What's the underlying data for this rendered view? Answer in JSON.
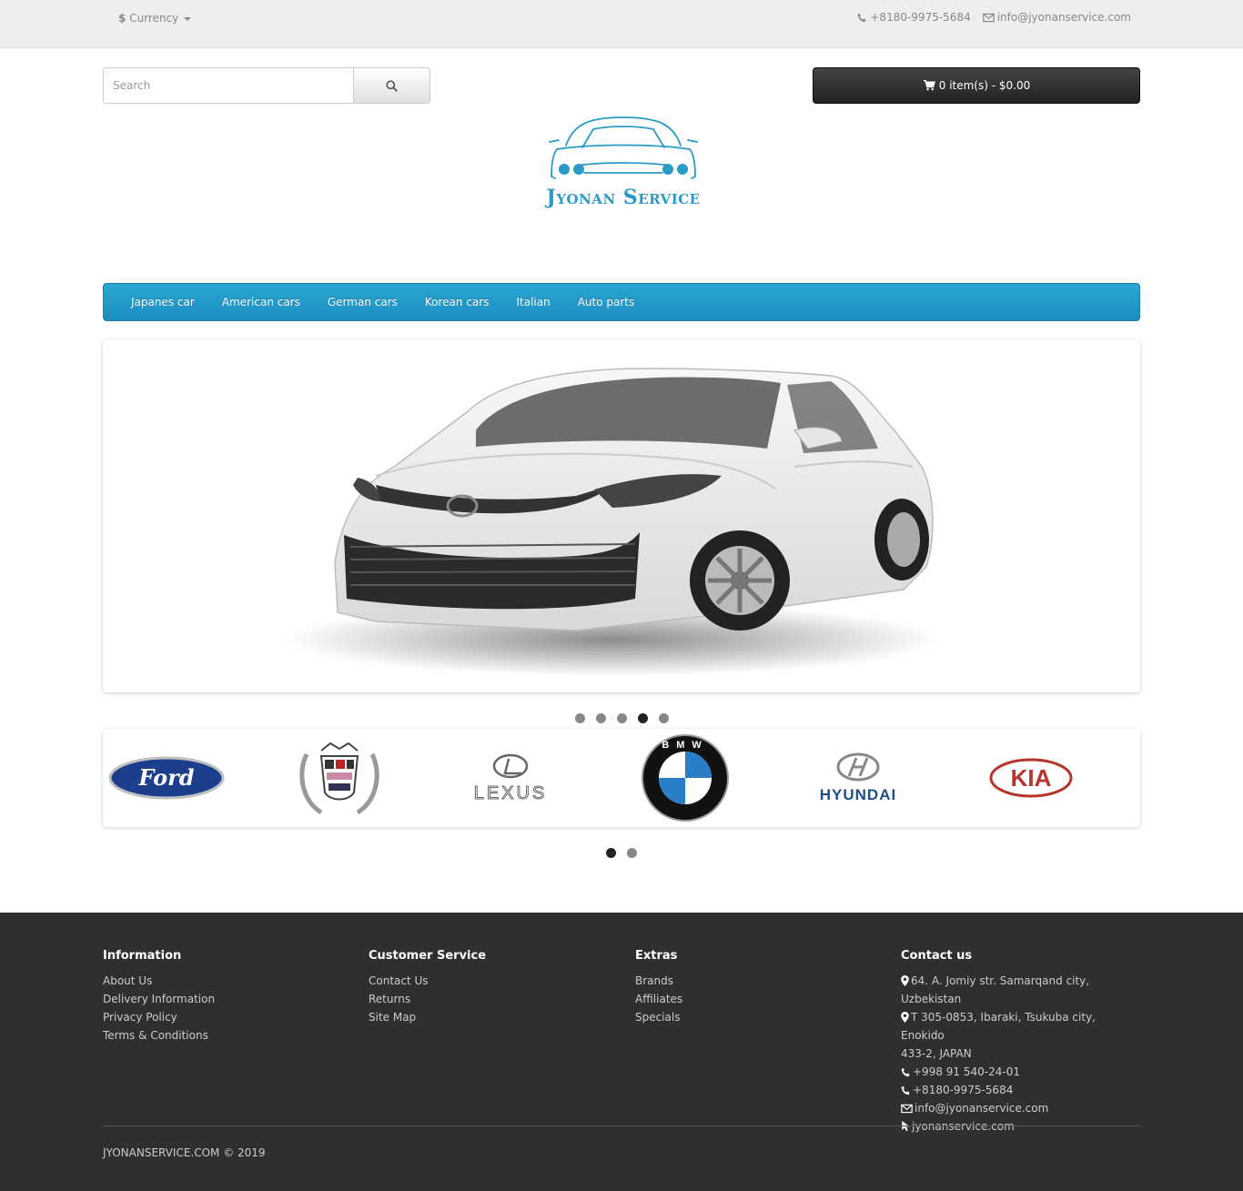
{
  "topbar": {
    "currency_symbol": "$",
    "currency_label": "Currency",
    "phone": "+8180-9975-5684",
    "email": "info@jyonanservice.com"
  },
  "search": {
    "placeholder": "Search"
  },
  "cart": {
    "label": "0 item(s) - $0.00"
  },
  "logo": {
    "text": "Jyonan Service",
    "color": "#2a9bc9"
  },
  "nav": {
    "items": [
      {
        "label": "Japanes car"
      },
      {
        "label": "American cars"
      },
      {
        "label": "German cars"
      },
      {
        "label": "Korean cars"
      },
      {
        "label": "Italian"
      },
      {
        "label": "Auto parts"
      }
    ]
  },
  "slideshow": {
    "slide_count": 5,
    "active_index": 3,
    "image": "white-toyota-camry"
  },
  "brands": {
    "items": [
      {
        "name": "Ford",
        "label": "Ford"
      },
      {
        "name": "Cadillac",
        "label": ""
      },
      {
        "name": "Lexus",
        "label": "LEXUS"
      },
      {
        "name": "BMW",
        "label": "BMW"
      },
      {
        "name": "Hyundai",
        "label": "HYUNDAI"
      },
      {
        "name": "KIA",
        "label": "KIA"
      }
    ],
    "page_count": 2,
    "active_page": 0
  },
  "footer": {
    "information": {
      "title": "Information",
      "links": [
        "About Us",
        "Delivery Information",
        "Privacy Policy",
        "Terms & Conditions"
      ]
    },
    "customer_service": {
      "title": "Customer Service",
      "links": [
        "Contact Us",
        "Returns",
        "Site Map"
      ]
    },
    "extras": {
      "title": "Extras",
      "links": [
        "Brands",
        "Affiliates",
        "Specials"
      ]
    },
    "contact": {
      "title": "Contact us",
      "address1": "64. A. Jomiy str. Samarqand city, Uzbekistan",
      "address2_line1": "T 305-0853, Ibaraki, Tsukuba city, Enokido",
      "address2_line2": "433-2, JAPAN",
      "phone1": "+998 91 540-24-01",
      "phone2": "+8180-9975-5684",
      "email": "info@jyonanservice.com",
      "website": "jyonanservice.com"
    },
    "copyright": "JYONANSERVICE.COM © 2019"
  }
}
